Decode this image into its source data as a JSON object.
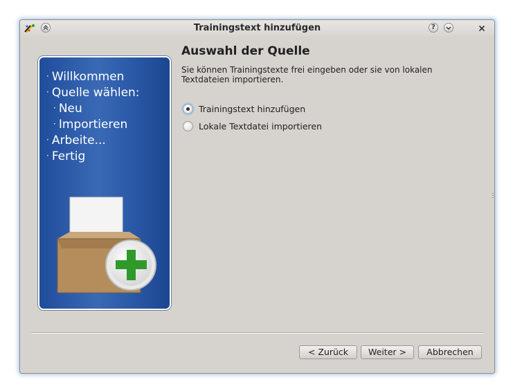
{
  "window": {
    "title": "Trainingstext hinzufügen",
    "accent_color": "#2a5aa8"
  },
  "titlebar": {
    "icons": [
      "app-icon",
      "keep-above-icon",
      "help-icon",
      "minimize-icon",
      "close-icon"
    ],
    "help_glyph": "?"
  },
  "sidebar": {
    "steps": [
      {
        "bullet": "·",
        "label": "Willkommen"
      },
      {
        "bullet": "·",
        "label": "Quelle wählen:"
      },
      {
        "bullet": "·",
        "label": "Neu"
      },
      {
        "bullet": "·",
        "label": "Importieren"
      },
      {
        "bullet": "·",
        "label": "Arbeite..."
      },
      {
        "bullet": "·",
        "label": "Fertig"
      }
    ]
  },
  "main": {
    "heading": "Auswahl der Quelle",
    "description": "Sie können Trainingstexte frei eingeben oder sie von lokalen Textdateien importieren.",
    "options": [
      {
        "label": "Trainingstext hinzufügen",
        "checked": true
      },
      {
        "label": "Lokale Textdatei importieren",
        "checked": false
      }
    ]
  },
  "buttons": {
    "back": "< Zurück",
    "next": "Weiter >",
    "cancel": "Abbrechen"
  }
}
